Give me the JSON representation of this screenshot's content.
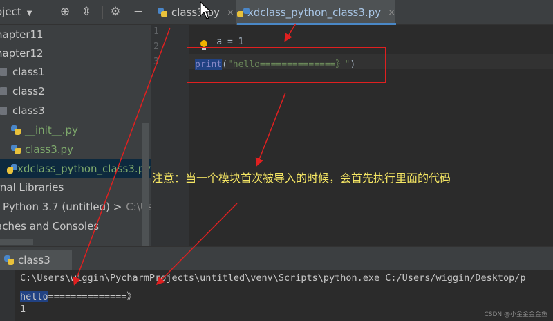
{
  "project_panel": {
    "title": "oject",
    "dropdown_glyph": "▼",
    "icons": [
      "crosshair-icon",
      "collapse-icon",
      "gear-icon",
      "minimize-icon"
    ],
    "items": [
      {
        "label": "napter11",
        "kind": "folder"
      },
      {
        "label": "napter12",
        "kind": "folder"
      },
      {
        "label": "class1",
        "kind": "folder"
      },
      {
        "label": "class2",
        "kind": "folder"
      },
      {
        "label": "class3",
        "kind": "folder"
      },
      {
        "label": "__init__.py",
        "kind": "python-file"
      },
      {
        "label": "class3.py",
        "kind": "python-file"
      },
      {
        "label": "xdclass_python_class3.py",
        "kind": "python-file",
        "selected": true
      },
      {
        "label": "rnal Libraries",
        "kind": "library"
      },
      {
        "label": "Python 3.7 (untitled) >",
        "suffix": "C:\\Users",
        "kind": "sdk"
      },
      {
        "label": "aches and Consoles",
        "kind": "scratch"
      }
    ]
  },
  "editor_tabs": [
    {
      "label": "class3.py",
      "active": false,
      "close": "×"
    },
    {
      "label": "xdclass_python_class3.py",
      "active": true,
      "close": "×"
    }
  ],
  "editor": {
    "line_numbers": [
      "1",
      "2",
      "3"
    ],
    "line1": "a = 1",
    "line3_func": "print",
    "line3_open": "(",
    "line3_string": "\"hello==============》\"",
    "line3_close": ")"
  },
  "annotation_note": "注意：当一个模块首次被导入的时候，会首先执行里面的代码",
  "run_panel": {
    "tab_label": "class3",
    "command": "C:\\Users\\wiggin\\PycharmProjects\\untitled\\venv\\Scripts\\python.exe C:/Users/wiggin/Desktop/p",
    "output_hello": "hello",
    "output_rest": "==============》",
    "output_line2": "1"
  },
  "watermark": "CSDN @小金金金金鱼",
  "colors": {
    "annotation_red": "#e02020",
    "note_yellow": "#f5e663",
    "selection_blue": "#214283",
    "active_tab_underline": "#4a88c7"
  }
}
